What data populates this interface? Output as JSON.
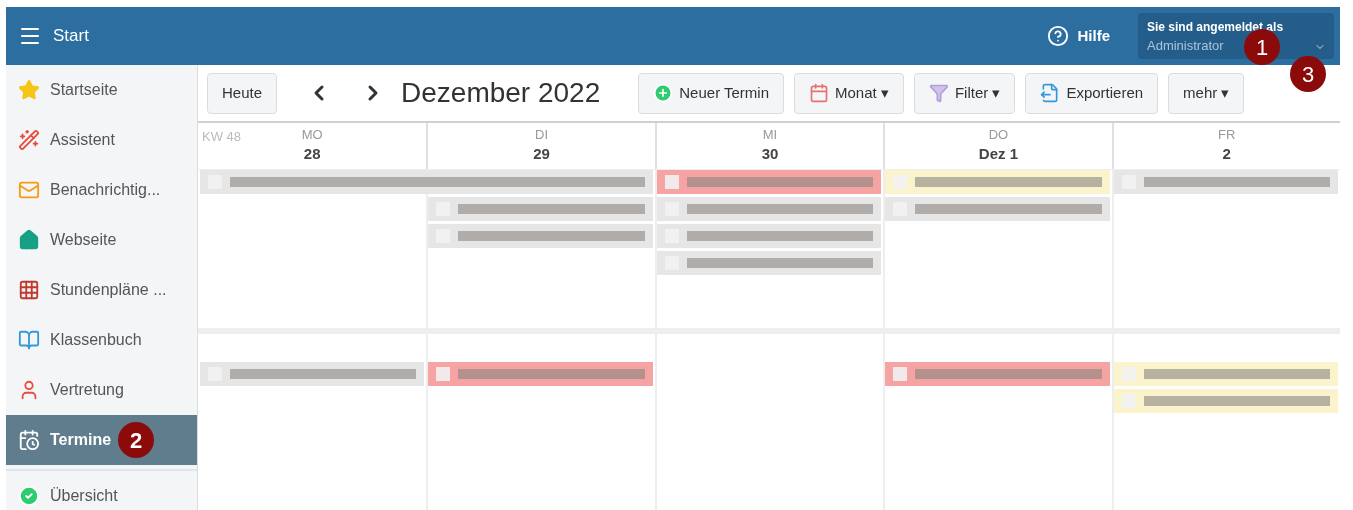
{
  "topbar": {
    "title": "Start",
    "help": "Hilfe",
    "login_label": "Sie sind angemeldet als",
    "login_user": "Administrator"
  },
  "sidebar": {
    "items": [
      {
        "label": "Startseite",
        "selected": false
      },
      {
        "label": "Assistent",
        "selected": false
      },
      {
        "label": "Benachrichtig...",
        "selected": false
      },
      {
        "label": "Webseite",
        "selected": false
      },
      {
        "label": "Stundenpläne ...",
        "selected": false
      },
      {
        "label": "Klassenbuch",
        "selected": false
      },
      {
        "label": "Vertretung",
        "selected": false
      },
      {
        "label": "Termine",
        "selected": true
      },
      {
        "label": "Übersicht",
        "selected": false
      }
    ]
  },
  "toolbar": {
    "today": "Heute",
    "month_title": "Dezember 2022",
    "buttons": [
      {
        "label": "Neuer Termin"
      },
      {
        "label": "Monat ▾"
      },
      {
        "label": "Filter ▾"
      },
      {
        "label": "Exportieren"
      },
      {
        "label": "mehr ▾"
      }
    ]
  },
  "calendar": {
    "week_label": "KW 48",
    "days": [
      {
        "weekday": "MO",
        "date": "28"
      },
      {
        "weekday": "DI",
        "date": "29"
      },
      {
        "weekday": "MI",
        "date": "30"
      },
      {
        "weekday": "DO",
        "date": "Dez 1"
      },
      {
        "weekday": "FR",
        "date": "2"
      }
    ],
    "weeks": [
      {
        "events": [
          {
            "color": "#e6e6e6"
          },
          {
            "color": "#f5a3a3"
          },
          {
            "color": "#fbf3cc"
          },
          {
            "color": "#e6e6e6"
          },
          {
            "color": "#e6e6e6"
          },
          {
            "color": "#e6e6e6"
          },
          {
            "color": "#e6e6e6"
          },
          {
            "color": "#e6e6e6"
          },
          {
            "color": "#e6e6e6"
          },
          {
            "color": "#e6e6e6"
          }
        ]
      },
      {
        "events": [
          {
            "color": "#e6e6e6"
          },
          {
            "color": "#f5a3a3"
          },
          {
            "color": "#f5a3a3"
          },
          {
            "color": "#fbf3cc"
          },
          {
            "color": "#fbf3cc"
          }
        ]
      }
    ]
  },
  "callouts": [
    {
      "number": "1"
    },
    {
      "number": "2"
    },
    {
      "number": "3"
    }
  ]
}
